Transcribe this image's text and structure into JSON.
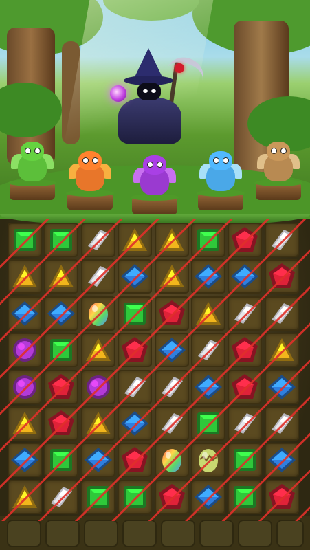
{
  "game": {
    "board": {
      "cols": 8,
      "rows": 8,
      "gems": [
        [
          "green",
          "green",
          "white",
          "yellow",
          "yellow",
          "green",
          "red",
          "white"
        ],
        [
          "yellow",
          "yellow",
          "white",
          "blue",
          "yellow",
          "blue",
          "blue",
          "red"
        ],
        [
          "blue",
          "blue",
          "rainbow",
          "green",
          "red",
          "yellow",
          "white",
          "white"
        ],
        [
          "purple",
          "green",
          "yellow",
          "red",
          "blue",
          "white",
          "red",
          "yellow"
        ],
        [
          "purple",
          "red",
          "purple",
          "white",
          "white",
          "blue",
          "red",
          "blue"
        ],
        [
          "yellow",
          "red",
          "yellow",
          "blue",
          "white",
          "green",
          "white",
          "white"
        ],
        [
          "blue",
          "green",
          "blue",
          "red",
          "rainbow",
          "egg",
          "green",
          "blue"
        ],
        [
          "yellow",
          "white",
          "green",
          "green",
          "red",
          "blue",
          "green",
          "red"
        ]
      ]
    },
    "colors": {
      "green": "#2fc83a",
      "yellow": "#f2b61c",
      "white": "#e6e6ea",
      "blue": "#2f7fe0",
      "red": "#e02238",
      "purple": "#b43ad8",
      "rainbow": "#f0c060",
      "egg": "#c8d870",
      "swipe_line": "#e0302a"
    },
    "characters": [
      {
        "name": "green-dragon",
        "color": "#5cbf3a",
        "accent": "#8be064"
      },
      {
        "name": "orange-dragon",
        "color": "#e8762a",
        "accent": "#f8b040"
      },
      {
        "name": "purple-dragon",
        "color": "#9a3ad0",
        "accent": "#c870f0"
      },
      {
        "name": "blue-dragon",
        "color": "#4aa8e8",
        "accent": "#a8e0f8"
      },
      {
        "name": "brown-dragon",
        "color": "#b88a52",
        "accent": "#e0c08a"
      }
    ],
    "boss": {
      "name": "dark-wizard-boss",
      "icon": "wizard-with-scythe-icon"
    }
  }
}
